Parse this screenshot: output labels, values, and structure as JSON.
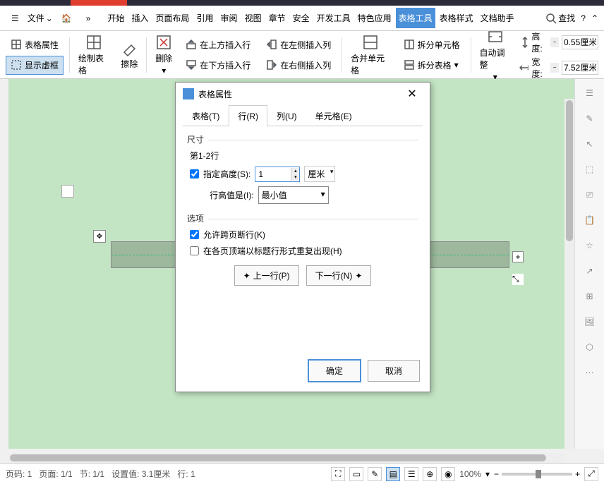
{
  "file_menu": "文件",
  "main_tabs": [
    "开始",
    "插入",
    "页面布局",
    "引用",
    "审阅",
    "视图",
    "章节",
    "安全",
    "开发工具",
    "特色应用",
    "表格工具",
    "表格样式",
    "文档助手"
  ],
  "main_tab_active_index": 10,
  "search_label": "查找",
  "ribbon": {
    "table_props": "表格属性",
    "show_grid": "显示虚框",
    "draw_table": "绘制表格",
    "eraser": "擦除",
    "delete": "删除",
    "insert_row_above": "在上方插入行",
    "insert_row_below": "在下方插入行",
    "insert_col_left": "在左侧插入列",
    "insert_col_right": "在右侧插入列",
    "merge_cells": "合并单元格",
    "split_cells": "拆分单元格",
    "split_table": "拆分表格",
    "auto_adjust": "自动调整",
    "height_label": "高度:",
    "width_label": "宽度:",
    "height_value": "0.55厘米",
    "width_value": "7.52厘米"
  },
  "dialog": {
    "title": "表格属性",
    "tabs": {
      "table": "表格(T)",
      "row": "行(R)",
      "column": "列(U)",
      "cell": "单元格(E)"
    },
    "active_tab": "row",
    "size_label": "尺寸",
    "row_range": "第1-2行",
    "specify_height": "指定高度(S):",
    "height_value": "1",
    "unit": "厘米",
    "row_height_is": "行高值是(I):",
    "row_height_mode": "最小值",
    "options_label": "选项",
    "allow_break": "允许跨页断行(K)",
    "repeat_header": "在各页顶端以标题行形式重复出现(H)",
    "prev_row": "上一行(P)",
    "next_row": "下一行(N)",
    "ok": "确定",
    "cancel": "取消"
  },
  "status": {
    "page_num": "页码: 1",
    "page": "页面: 1/1",
    "section": "节: 1/1",
    "ruler": "设置值: 3.1厘米",
    "row": "行: 1",
    "zoom": "100%"
  }
}
